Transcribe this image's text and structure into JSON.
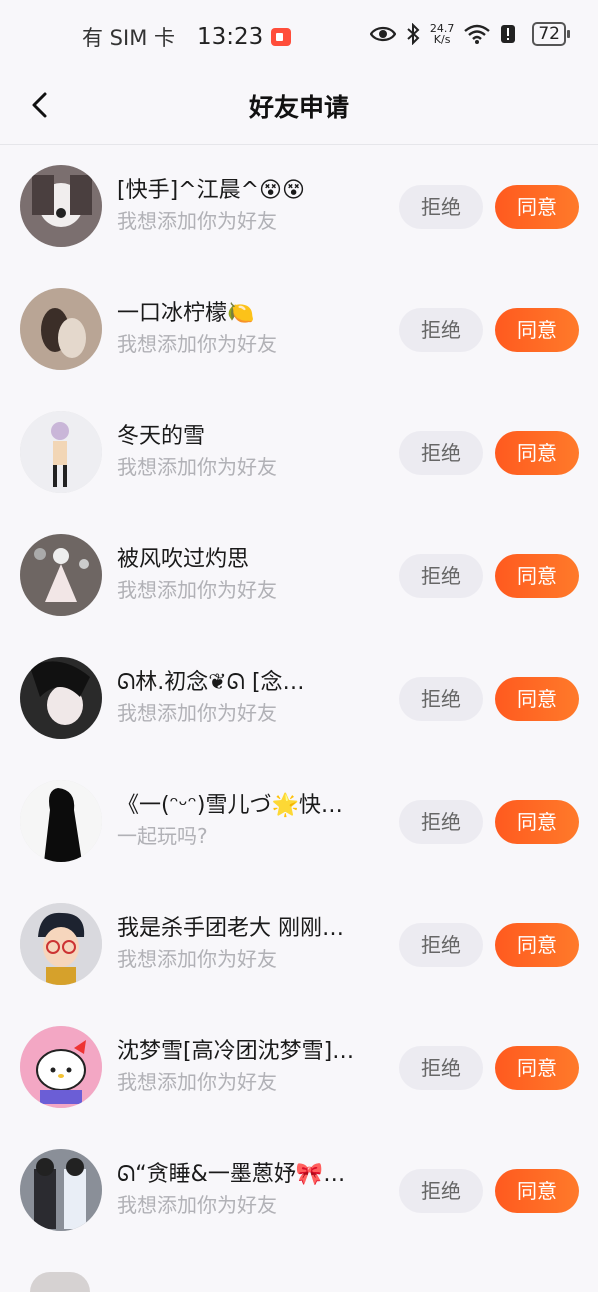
{
  "status_bar": {
    "carrier": "有 SIM 卡",
    "time": "13:23",
    "net_speed_value": "24.7",
    "net_speed_unit": "K/s",
    "battery": "72"
  },
  "header": {
    "title": "好友申请"
  },
  "buttons": {
    "reject": "拒绝",
    "accept": "同意"
  },
  "requests": [
    {
      "name": "[快手]^江晨^😵😵",
      "message": "我想添加你为好友"
    },
    {
      "name": "一口冰柠檬🍋",
      "message": "我想添加你为好友"
    },
    {
      "name": "冬天的雪",
      "message": "我想添加你为好友"
    },
    {
      "name": "被风吹过灼思",
      "message": "我想添加你为好友"
    },
    {
      "name": "ᘏ林.初念❦ᘏ [念…",
      "message": "我想添加你为好友"
    },
    {
      "name": "《一(ᵔᵕᵔ)雪儿づ🌟快…",
      "message": "一起玩吗?"
    },
    {
      "name": "我是杀手团老大 刚刚…",
      "message": "我想添加你为好友"
    },
    {
      "name": "沈梦雪[高冷团沈梦雪]…",
      "message": "我想添加你为好友"
    },
    {
      "name": "ᘏ“贪睡&一墨蒽妤🎀…",
      "message": "我想添加你为好友"
    }
  ]
}
